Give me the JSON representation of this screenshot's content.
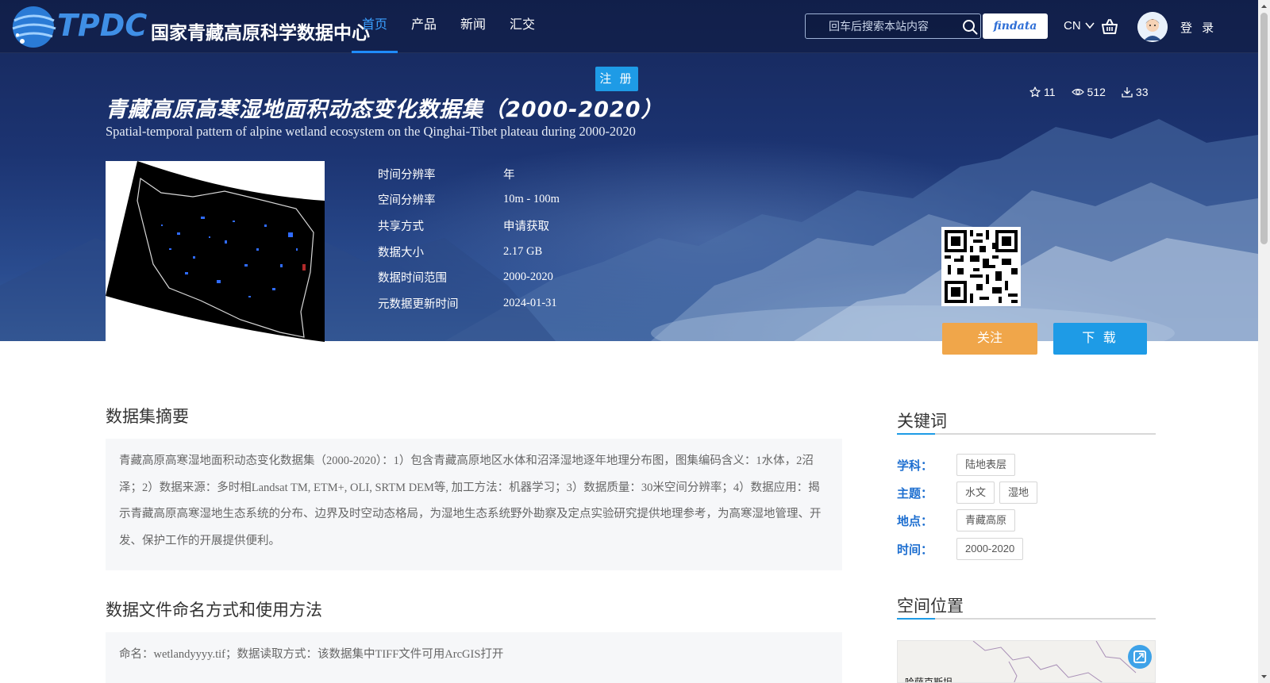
{
  "header": {
    "logo_acronym": "TPDC",
    "logo_text": "国家青藏高原科学数据中心",
    "nav": [
      {
        "label": "首页",
        "active": true
      },
      {
        "label": "产品",
        "active": false
      },
      {
        "label": "新闻",
        "active": false
      },
      {
        "label": "汇交",
        "active": false
      }
    ],
    "search_placeholder": "回车后搜索本站内容",
    "findata_label": "findata",
    "lang_label": "CN",
    "login_label": "登 录"
  },
  "register_label": "注 册",
  "dataset": {
    "title_cn": "青藏高原高寒湿地面积动态变化数据集（2000-2020）",
    "title_en": "Spatial-temporal pattern of alpine wetland ecosystem on the Qinghai-Tibet plateau during 2000-2020",
    "stats": {
      "favorites": "11",
      "views": "512",
      "downloads": "33"
    },
    "meta": [
      {
        "key": "时间分辨率",
        "value": "年"
      },
      {
        "key": "空间分辨率",
        "value": "10m - 100m"
      },
      {
        "key": "共享方式",
        "value": "申请获取"
      },
      {
        "key": "数据大小",
        "value": "2.17 GB"
      },
      {
        "key": "数据时间范围",
        "value": "2000-2020"
      },
      {
        "key": "元数据更新时间",
        "value": "2024-01-31"
      }
    ],
    "follow_label": "关注",
    "download_label": "下 载"
  },
  "abstract": {
    "title": "数据集摘要",
    "text": "青藏高原高寒湿地面积动态变化数据集（2000-2020）：1）包含青藏高原地区水体和沼泽湿地逐年地理分布图，图集编码含义：1水体，2沼泽；2）数据来源：多时相Landsat TM, ETM+, OLI, SRTM DEM等, 加工方法：机器学习；3）数据质量：30米空间分辨率；4）数据应用：揭示青藏高原高寒湿地生态系统的分布、边界及时空动态格局，为湿地生态系统野外勘察及定点实验研究提供地理参考，为高寒湿地管理、开发、保护工作的开展提供便利。"
  },
  "naming": {
    "title": "数据文件命名方式和使用方法",
    "text": "命名：wetlandyyyy.tif；数据读取方式：该数据集中TIFF文件可用ArcGIS打开"
  },
  "sidebar": {
    "keywords_title": "关键词",
    "keywords": [
      {
        "label": "学科：",
        "tags": [
          "陆地表层"
        ]
      },
      {
        "label": "主题：",
        "tags": [
          "水文",
          "湿地"
        ]
      },
      {
        "label": "地点：",
        "tags": [
          "青藏高原"
        ]
      },
      {
        "label": "时间：",
        "tags": [
          "2000-2020"
        ]
      }
    ],
    "location_title": "空间位置",
    "map_label": "哈萨克斯坦"
  },
  "colors": {
    "accent": "#1e9be6",
    "follow": "#f0a64a",
    "nav_active": "#3aa0ff",
    "keyword_label": "#1e6fd0"
  }
}
